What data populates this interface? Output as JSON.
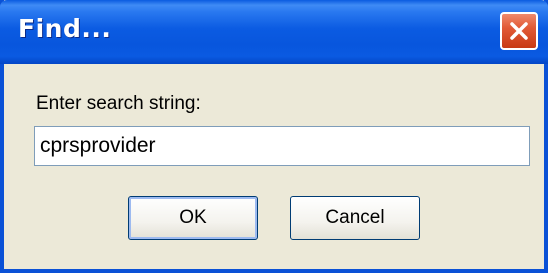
{
  "dialog": {
    "title": "Find...",
    "prompt_label": "Enter search string:",
    "search_value": "cprsprovider",
    "ok_label": "OK",
    "cancel_label": "Cancel"
  },
  "icons": {
    "close": "close-icon"
  },
  "colors": {
    "titlebar": "#0a5ae2",
    "window_border": "#0a51d6",
    "dialog_background": "#ece9d8",
    "close_button": "#e25a36",
    "input_border": "#7f9db9"
  }
}
